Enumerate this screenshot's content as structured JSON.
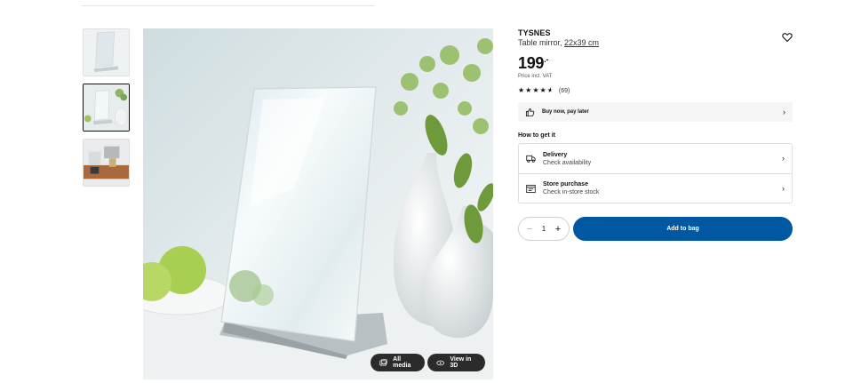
{
  "product": {
    "name": "TYSNES",
    "description": "Table mirror,",
    "size": "22x39 cm",
    "price_main": "199",
    "price_decimal": ".-",
    "price_note": "Price incl. VAT",
    "rating_stars": 4.5,
    "review_count": "(69)"
  },
  "gallery": {
    "thumbnails": [
      {
        "icon": "mirror-thumbnail"
      },
      {
        "icon": "mirror-with-vase-thumbnail",
        "selected": true
      },
      {
        "icon": "room-scene-thumbnail"
      }
    ],
    "all_media_label": "All media",
    "view_3d_label": "View in 3D"
  },
  "payment": {
    "bnpl_label": "Buy now, pay later"
  },
  "fulfillment": {
    "title": "How to get it",
    "options": [
      {
        "icon": "truck-icon",
        "title": "Delivery",
        "subtitle": "Check availability"
      },
      {
        "icon": "store-icon",
        "title": "Store purchase",
        "subtitle": "Check in-store stock"
      }
    ]
  },
  "cart": {
    "quantity": "1",
    "add_to_bag_label": "Add to bag",
    "accent_color": "#0058a3"
  }
}
